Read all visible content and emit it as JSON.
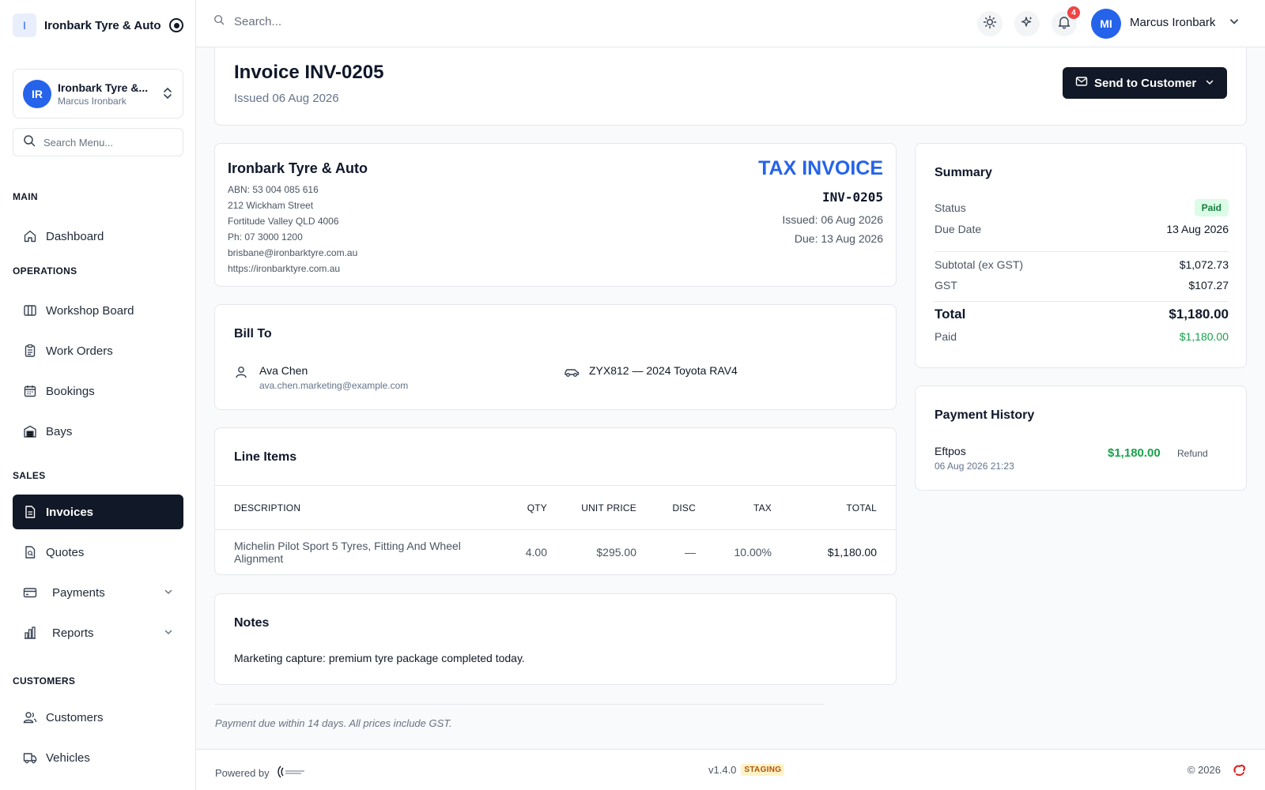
{
  "sidebar": {
    "brand": {
      "initial": "I",
      "name": "Ironbark Tyre & Auto"
    },
    "workspace": {
      "initials": "IR",
      "title": "Ironbark Tyre &...",
      "subtitle": "Marcus Ironbark"
    },
    "search_placeholder": "Search Menu...",
    "sections": {
      "main": "MAIN",
      "operations": "OPERATIONS",
      "sales": "SALES",
      "customers": "CUSTOMERS"
    },
    "items": {
      "dashboard": "Dashboard",
      "workshop_board": "Workshop Board",
      "work_orders": "Work Orders",
      "bookings": "Bookings",
      "bays": "Bays",
      "invoices": "Invoices",
      "quotes": "Quotes",
      "payments": "Payments",
      "reports": "Reports",
      "customers": "Customers",
      "vehicles": "Vehicles"
    },
    "active_item": "invoices"
  },
  "topbar": {
    "search_placeholder": "Search...",
    "notifications_count": "4",
    "user_initials": "MI",
    "user_name": "Marcus Ironbark"
  },
  "header": {
    "title": "Invoice INV-0205",
    "subtitle": "Issued 06 Aug 2026",
    "send_button": "Send to Customer"
  },
  "company": {
    "name": "Ironbark Tyre & Auto",
    "abn": "ABN: 53 004 085 616",
    "street": "212 Wickham Street",
    "city": "Fortitude Valley QLD 4006",
    "phone": "Ph: 07 3000 1200",
    "email": "brisbane@ironbarktyre.com.au",
    "website": "https://ironbarktyre.com.au",
    "doc_type": "TAX INVOICE",
    "invoice_number": "INV-0205",
    "issued": "Issued: 06 Aug 2026",
    "due": "Due: 13 Aug 2026"
  },
  "bill_to": {
    "title": "Bill To",
    "customer_name": "Ava Chen",
    "customer_email": "ava.chen.marketing@example.com",
    "vehicle": "ZYX812 — 2024 Toyota RAV4"
  },
  "line_items": {
    "title": "Line Items",
    "columns": [
      "DESCRIPTION",
      "QTY",
      "UNIT PRICE",
      "DISC",
      "TAX",
      "TOTAL"
    ],
    "rows": [
      {
        "description": "Michelin Pilot Sport 5 Tyres, Fitting And Wheel Alignment",
        "qty": "4.00",
        "unit_price": "$295.00",
        "disc": "—",
        "tax": "10.00%",
        "total": "$1,180.00"
      }
    ]
  },
  "notes": {
    "title": "Notes",
    "text": "Marketing capture: premium tyre package completed today."
  },
  "footer_note": "Payment due within 14 days. All prices include GST.",
  "summary": {
    "title": "Summary",
    "status_label": "Status",
    "status_value": "Paid",
    "due_label": "Due Date",
    "due_value": "13 Aug 2026",
    "subtotal_label": "Subtotal (ex GST)",
    "subtotal_value": "$1,072.73",
    "gst_label": "GST",
    "gst_value": "$107.27",
    "total_label": "Total",
    "total_value": "$1,180.00",
    "paid_label": "Paid",
    "paid_value": "$1,180.00"
  },
  "payment_history": {
    "title": "Payment History",
    "entries": [
      {
        "method": "Eftpos",
        "date": "06 Aug 2026 21:23",
        "amount": "$1,180.00",
        "action": "Refund"
      }
    ]
  },
  "bottombar": {
    "powered_by": "Powered by",
    "version": "v1.4.0",
    "env_badge": "STAGING",
    "copyright": "© 2026"
  },
  "colors": {
    "accent": "#2563eb",
    "dark": "#111827",
    "success": "#16a34a",
    "danger": "#ef4444"
  }
}
